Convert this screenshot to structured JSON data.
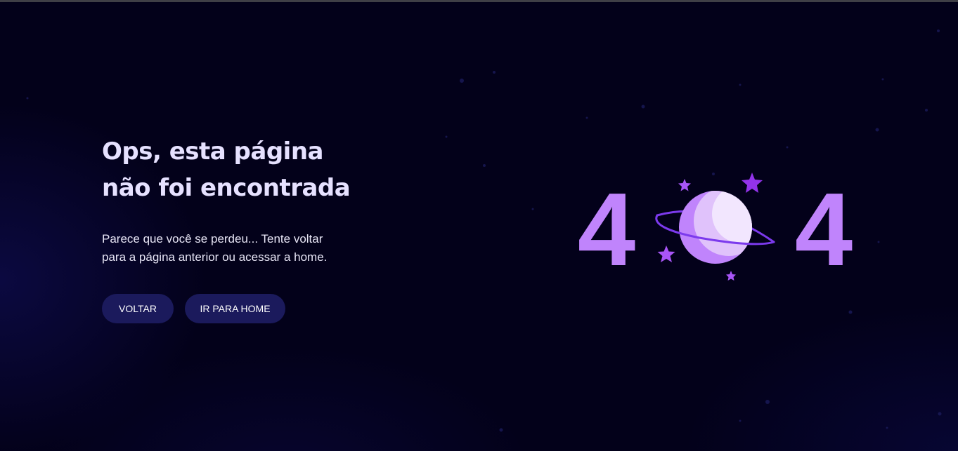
{
  "error_page": {
    "title_line1": "Ops, esta página",
    "title_line2": "não foi encontrada",
    "description_line1": "Parece que você se perdeu... Tente voltar",
    "description_line2": "para a página anterior ou acessar a home.",
    "back_button": "VOLTAR",
    "home_button": "IR PARA HOME"
  },
  "illustration": {
    "digit_left": "4",
    "digit_right": "4",
    "icon": "planet-with-ring-icon"
  },
  "colors": {
    "background": "#03011a",
    "title": "#e6e1ff",
    "button_bg": "#1b1a5c",
    "accent_purple": "#c084fc",
    "star_purple": "#9333ea"
  }
}
